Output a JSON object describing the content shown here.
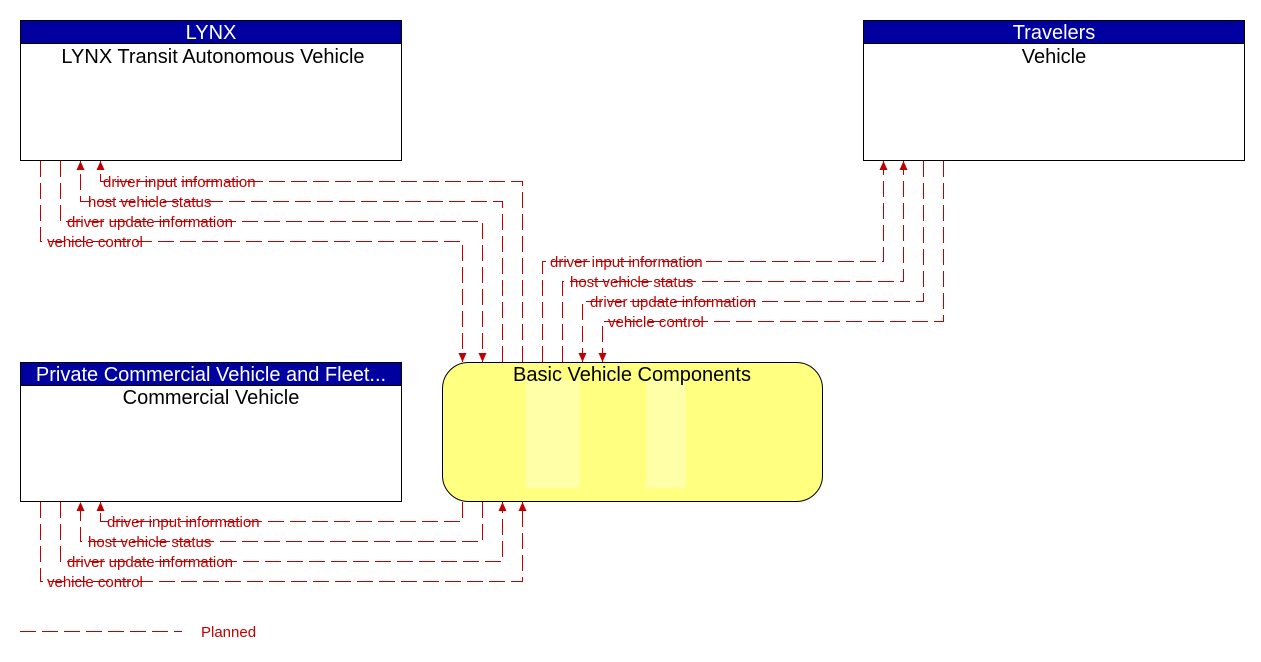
{
  "elements": {
    "lynx": {
      "header": "LYNX",
      "name": "LYNX Transit Autonomous Vehicle"
    },
    "travelers": {
      "header": "Travelers",
      "name": "Vehicle"
    },
    "commercial": {
      "header": "Private Commercial Vehicle and Fleet...",
      "name": "Commercial Vehicle"
    },
    "bvc": {
      "name": "Basic Vehicle Components"
    }
  },
  "flows": {
    "lynx": [
      "driver input information",
      "host vehicle status",
      "driver update information",
      "vehicle control"
    ],
    "vehicle": [
      "driver input information",
      "host vehicle status",
      "driver update information",
      "vehicle control"
    ],
    "commercial": [
      "driver input information",
      "host vehicle status",
      "driver update information",
      "vehicle control"
    ]
  },
  "legend": {
    "planned": "Planned"
  },
  "colors": {
    "header": "#0000a0",
    "flow": "#c00000",
    "bvc_fill": "#ffff80"
  }
}
